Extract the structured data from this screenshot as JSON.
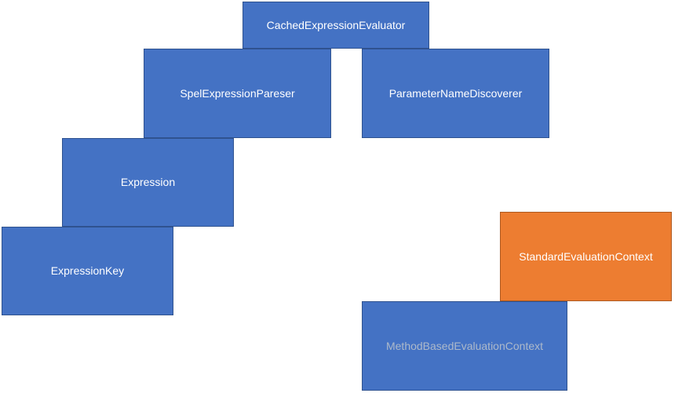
{
  "boxes": {
    "cached_expression_evaluator": "CachedExpressionEvaluator",
    "spel_expression_parser": "SpelExpressionPareser",
    "parameter_name_discoverer": "ParameterNameDiscoverer",
    "expression": "Expression",
    "expression_key": "ExpressionKey",
    "standard_evaluation_context": "StandardEvaluationContext",
    "method_based_evaluation_context": "MethodBasedEvaluationContext"
  },
  "colors": {
    "blue_fill": "#4472C4",
    "blue_border": "#2F528F",
    "orange_fill": "#ED7D31",
    "orange_border": "#AE5A21",
    "muted_text": "#ADB9CA"
  }
}
